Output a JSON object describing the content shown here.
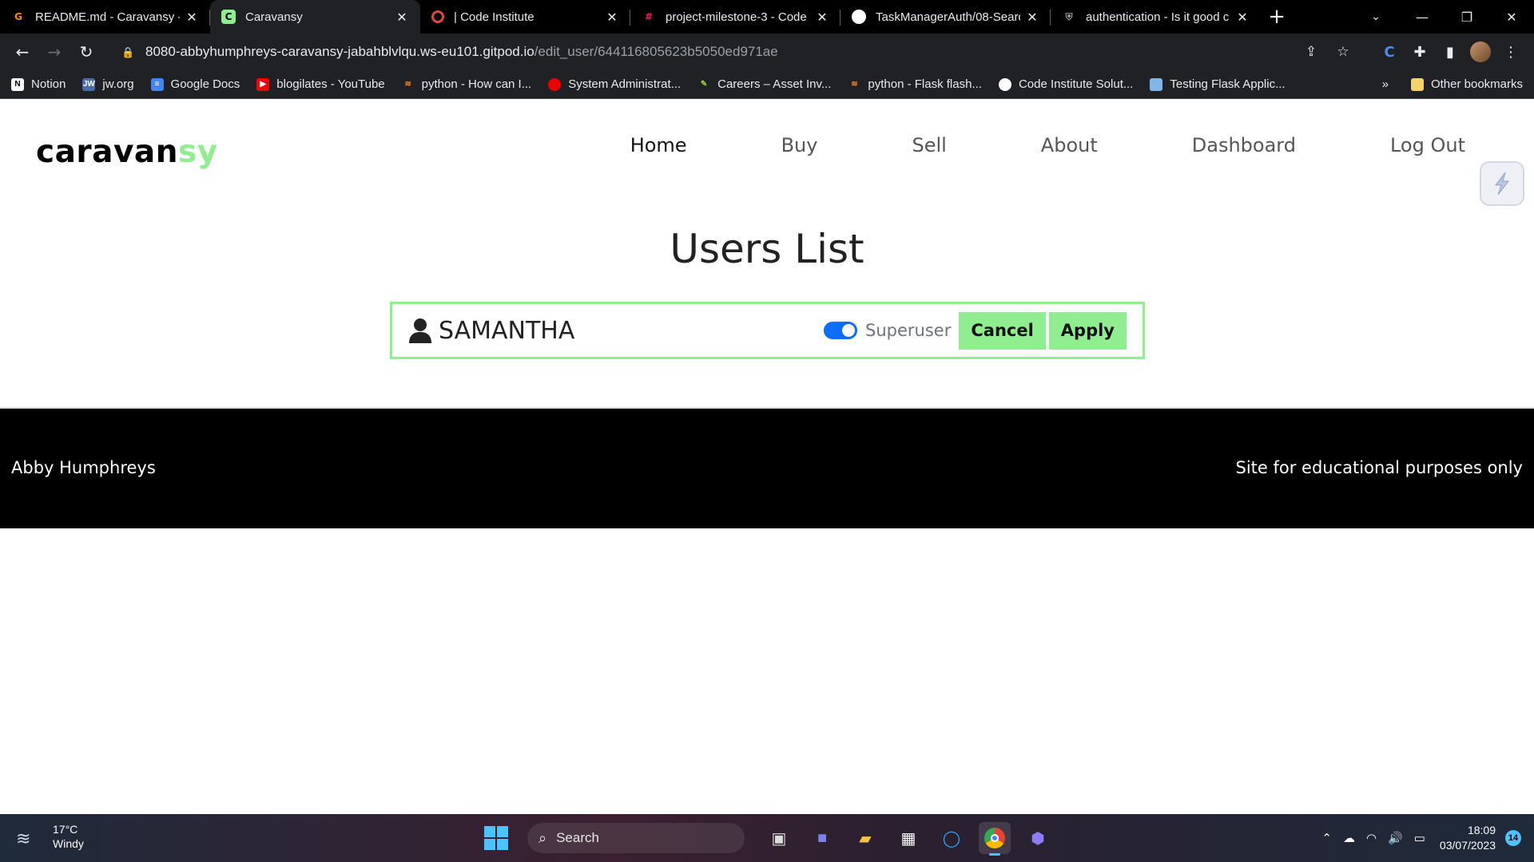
{
  "browser": {
    "tabs": [
      {
        "title": "README.md - Caravansy - G",
        "favicon": "gitpod-icon",
        "active": false
      },
      {
        "title": "Caravansy",
        "favicon": "caravansy-icon",
        "active": true
      },
      {
        "title": "| Code Institute",
        "favicon": "code-institute-icon",
        "active": false
      },
      {
        "title": "project-milestone-3 - Code",
        "favicon": "slack-icon",
        "active": false
      },
      {
        "title": "TaskManagerAuth/08-Searc",
        "favicon": "github-icon",
        "active": false
      },
      {
        "title": "authentication - Is it good c",
        "favicon": "shield-icon",
        "active": false
      }
    ],
    "url_host": "8080-abbyhumphreys-caravansy-jabahblvlqu.ws-eu101.gitpod.io",
    "url_path": "/edit_user/644116805623b5050ed971ae",
    "bookmarks": [
      {
        "label": "Notion",
        "icon": "notion-icon",
        "color": "#ffffff"
      },
      {
        "label": "jw.org",
        "icon": "jw-icon",
        "color": "#4a6da7"
      },
      {
        "label": "Google Docs",
        "icon": "docs-icon",
        "color": "#4285f4"
      },
      {
        "label": "blogilates - YouTube",
        "icon": "youtube-icon",
        "color": "#ff0000"
      },
      {
        "label": "python - How can I...",
        "icon": "stackoverflow-icon",
        "color": "#f48024"
      },
      {
        "label": "System Administrat...",
        "icon": "redhat-icon",
        "color": "#ee0000"
      },
      {
        "label": "Careers – Asset Inv...",
        "icon": "careers-icon",
        "color": "#9acd32"
      },
      {
        "label": "python - Flask flash...",
        "icon": "stackoverflow-icon",
        "color": "#f48024"
      },
      {
        "label": "Code Institute Solut...",
        "icon": "github-icon",
        "color": "#ffffff"
      },
      {
        "label": "Testing Flask Applic...",
        "icon": "cube-icon",
        "color": "#7fb8e6"
      }
    ],
    "other_bookmarks": "Other bookmarks"
  },
  "site": {
    "brand_main": "caravan",
    "brand_accent": "sy",
    "accent_color": "#90ee90",
    "nav": [
      "Home",
      "Buy",
      "Sell",
      "About",
      "Dashboard",
      "Log Out"
    ],
    "heading": "Users List",
    "user": {
      "name": "SAMANTHA",
      "superuser_label": "Superuser",
      "superuser_on": true,
      "cancel_label": "Cancel",
      "apply_label": "Apply"
    },
    "footer": {
      "left": "Abby Humphreys",
      "right": "Site for educational purposes only"
    }
  },
  "taskbar": {
    "temperature": "17°C",
    "condition": "Windy",
    "search_placeholder": "Search",
    "time": "18:09",
    "date": "03/07/2023",
    "notifications": "14"
  }
}
